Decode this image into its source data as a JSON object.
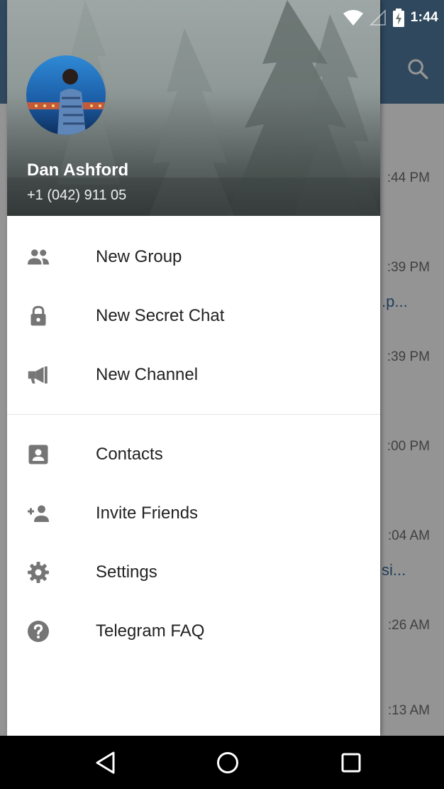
{
  "status_bar": {
    "time": "1:44"
  },
  "drawer": {
    "user": {
      "name": "Dan Ashford",
      "phone": "+1 (042) 911 05"
    },
    "menu": [
      {
        "label": "New Group",
        "icon": "group-icon"
      },
      {
        "label": "New Secret Chat",
        "icon": "lock-icon"
      },
      {
        "label": "New Channel",
        "icon": "megaphone-icon"
      },
      {
        "label": "Contacts",
        "icon": "contacts-icon"
      },
      {
        "label": "Invite Friends",
        "icon": "add-person-icon"
      },
      {
        "label": "Settings",
        "icon": "gear-icon"
      },
      {
        "label": "Telegram FAQ",
        "icon": "help-icon"
      }
    ]
  },
  "background_chats": [
    {
      "time": ":44 PM",
      "snippet": ""
    },
    {
      "time": ":39 PM",
      "snippet": ".p..."
    },
    {
      "time": ":39 PM",
      "snippet": ""
    },
    {
      "time": ":00 PM",
      "snippet": ""
    },
    {
      "time": ":04 AM",
      "snippet": "si..."
    },
    {
      "time": ":26 AM",
      "snippet": ""
    },
    {
      "time": ":13 AM",
      "snippet": ""
    }
  ],
  "colors": {
    "toolbar": "#527da3",
    "icon_gray": "#757575",
    "text": "#222222",
    "nav_bar": "#000000"
  }
}
